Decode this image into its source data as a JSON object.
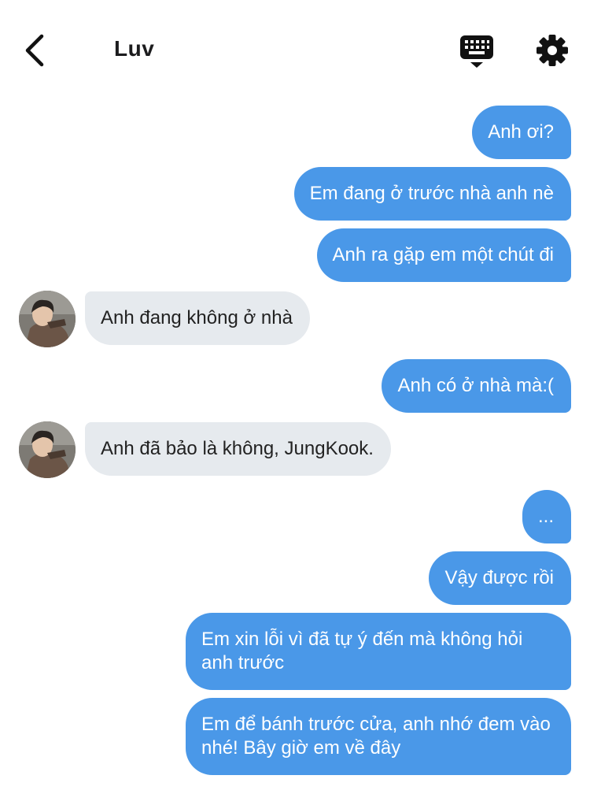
{
  "header": {
    "title": "Luv",
    "back_icon": "chevron-left-icon",
    "keyboard_icon": "keyboard-icon",
    "settings_icon": "gear-icon"
  },
  "colors": {
    "outgoing_bubble": "#4a98e8",
    "incoming_bubble": "#e6eaee",
    "icon": "#111111"
  },
  "messages": [
    {
      "side": "out",
      "text": "Anh ơi?"
    },
    {
      "side": "out",
      "text": "Em đang ở trước nhà anh nè"
    },
    {
      "side": "out",
      "text": "Anh ra gặp em một chút đi"
    },
    {
      "side": "in",
      "text": "Anh đang không ở nhà"
    },
    {
      "side": "out",
      "text": "Anh có ở nhà mà:("
    },
    {
      "side": "in",
      "text": "Anh đã bảo là không, JungKook."
    },
    {
      "side": "out",
      "text": "..."
    },
    {
      "side": "out",
      "text": "Vậy được rồi"
    },
    {
      "side": "out",
      "text": "Em xin lỗi vì đã tự ý đến mà không hỏi anh trước"
    },
    {
      "side": "out",
      "text": "Em để bánh trước cửa, anh nhớ đem vào nhé! Bây giờ em về đây"
    }
  ]
}
